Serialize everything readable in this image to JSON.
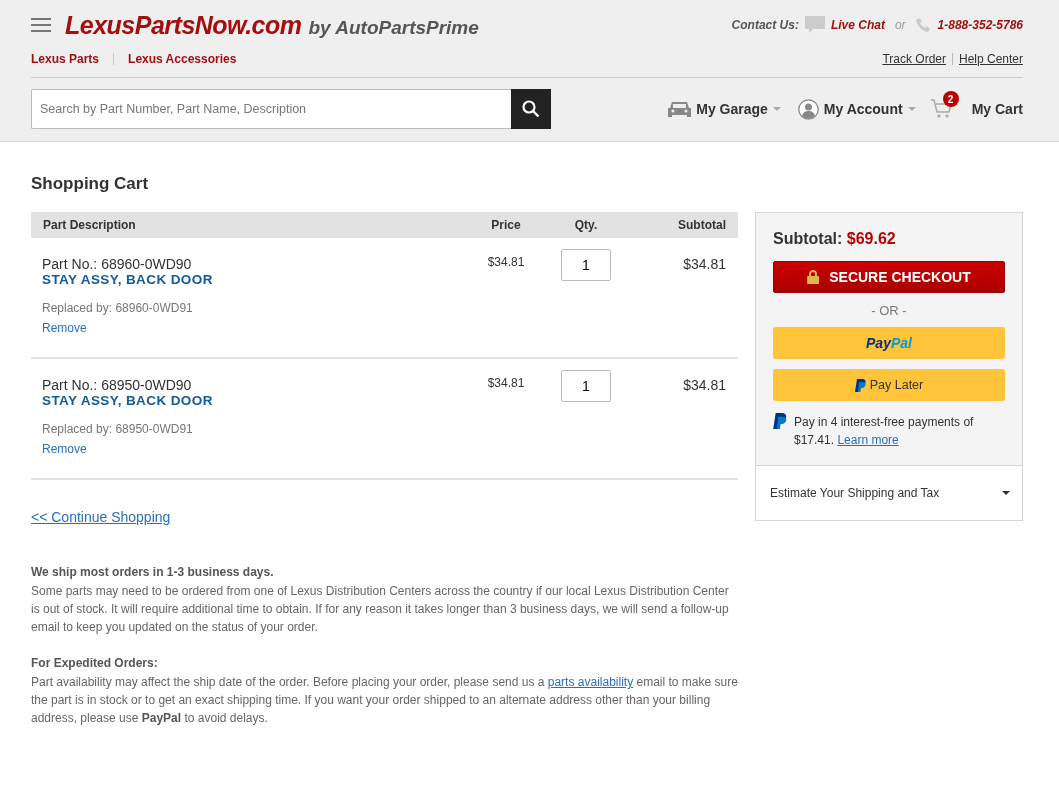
{
  "header": {
    "logo": "LexusPartsNow.com",
    "logo_suffix": "by AutoPartsPrime",
    "contact_label": "Contact Us:",
    "live_chat": "Live Chat",
    "or": "or",
    "phone": "1-888-352-5786",
    "nav": [
      "Lexus Parts",
      "Lexus Accessories"
    ],
    "util_links": [
      "Track Order",
      "Help Center"
    ],
    "search": {
      "placeholder": "Search by Part Number, Part Name, Description"
    },
    "garage": "My Garage",
    "account": "My Account",
    "cart": "My Cart",
    "cart_count": "2"
  },
  "page_title": "Shopping Cart",
  "table": {
    "columns": [
      "Part Description",
      "Price",
      "Qty.",
      "Subtotal"
    ],
    "rows": [
      {
        "part_no": "Part No.: 68960-0WD90",
        "name": "STAY ASSY, BACK DOOR",
        "replaced": "Replaced by: 68960-0WD91",
        "remove": "Remove",
        "price": "$34.81",
        "qty": "1",
        "subtotal": "$34.81"
      },
      {
        "part_no": "Part No.: 68950-0WD90",
        "name": "STAY ASSY, BACK DOOR",
        "replaced": "Replaced by: 68950-0WD91",
        "remove": "Remove",
        "price": "$34.81",
        "qty": "1",
        "subtotal": "$34.81"
      }
    ]
  },
  "continue": "<< Continue Shopping",
  "summary": {
    "subtotal_label": "Subtotal:",
    "subtotal": "$69.62",
    "checkout": "SECURE CHECKOUT",
    "or": "- OR -",
    "paypal_a": "Pay",
    "paypal_b": "Pal",
    "pay_later": "Pay Later",
    "pay_in_4": "Pay in 4 interest-free payments of $17.41.",
    "learn_more": "Learn more",
    "estimate": "Estimate Your Shipping and Tax"
  },
  "notes": [
    {
      "heading": "We ship most orders in 1-3 business days.",
      "text": "Some parts may need to be ordered from one of Lexus Distribution Centers across the country if our local Lexus Distribution Center is out of stock. It will require additional time to obtain. If for any reason it takes longer than 3 business days, we will send a follow-up email to keep you updated on the status of your order."
    },
    {
      "heading": "For Expedited Orders:",
      "text": "Part availability may affect the ship date of the order. Before placing your order, please send us a",
      "link": "parts availability",
      "text_after": "email to make sure the part is in stock or to get an exact shipping time. If you want your order shipped to an alternate address other than your billing address, please use **PayPal** to avoid delays."
    }
  ]
}
